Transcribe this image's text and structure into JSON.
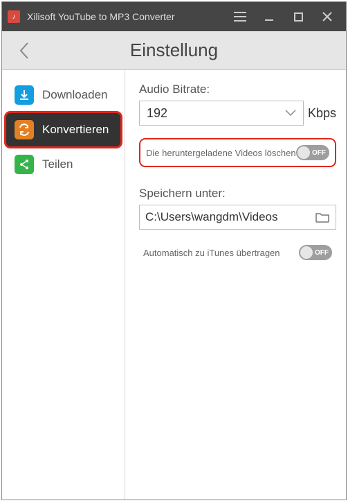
{
  "app": {
    "title": "Xilisoft YouTube to MP3 Converter"
  },
  "header": {
    "title": "Einstellung"
  },
  "sidebar": {
    "items": [
      {
        "label": "Downloaden"
      },
      {
        "label": "Konvertieren"
      },
      {
        "label": "Teilen"
      }
    ]
  },
  "panel": {
    "bitrate_label": "Audio Bitrate:",
    "bitrate_value": "192",
    "bitrate_unit": "Kbps",
    "delete_label": "Die heruntergeladene Videos löschen",
    "delete_state": "OFF",
    "save_label": "Speichern unter:",
    "save_path": "C:\\Users\\wangdm\\Videos",
    "itunes_label": "Automatisch zu iTunes übertragen",
    "itunes_state": "OFF"
  }
}
